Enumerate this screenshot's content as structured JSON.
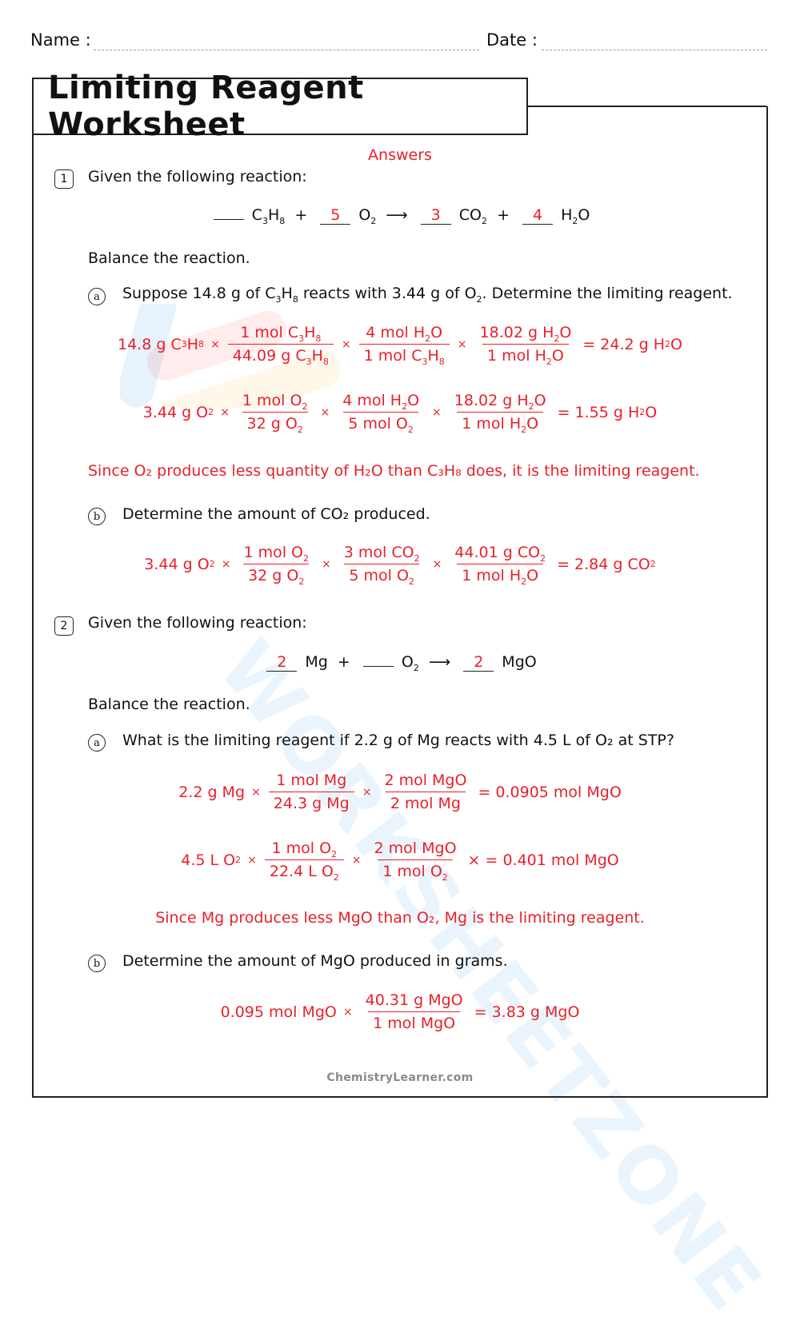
{
  "header": {
    "name_label": "Name :",
    "date_label": "Date :"
  },
  "title": "Limiting Reagent Worksheet",
  "answers_label": "Answers",
  "colors": {
    "answer": "#e8202a",
    "text": "#111111",
    "footer": "#8a8a8a"
  },
  "q1": {
    "number": "1",
    "prompt": "Given the following reaction:",
    "reaction": {
      "c1": "",
      "c2": "5",
      "c3": "3",
      "c4": "4"
    },
    "instruction": "Balance the reaction.",
    "a": {
      "marker": "a",
      "question_pre": "Suppose 14.8 g of C",
      "question_mid1": " reacts with 3.44 g of O",
      "question_post": ". Determine the limiting reagent.",
      "calc1": {
        "start": "14.8 g C",
        "f1_num": "1 mol C",
        "f1_den": "44.09 g C",
        "f2_num": "4 mol H",
        "f2_den": "1 mol C",
        "f3_num": "18.02 g H",
        "f3_den": "1 mol H",
        "result": "= 24.2 g H"
      },
      "calc2": {
        "start": "3.44 g O",
        "f1_num": "1 mol O",
        "f1_den": "32 g O",
        "f2_num": "4 mol H",
        "f2_den": "5 mol O",
        "f3_num": "18.02 g H",
        "f3_den": "1 mol H",
        "result": "= 1.55 g H"
      },
      "conclusion": "Since O₂ produces less quantity of H₂O than C₃H₈ does, it is the limiting reagent."
    },
    "b": {
      "marker": "b",
      "question": "Determine the amount of CO₂ produced.",
      "calc": {
        "start": "3.44 g O",
        "f1_num": "1 mol O",
        "f1_den": "32 g O",
        "f2_num": "3 mol CO",
        "f2_den": "5 mol O",
        "f3_num": "44.01 g CO",
        "f3_den": "1 mol H",
        "result": "= 2.84 g CO"
      }
    }
  },
  "q2": {
    "number": "2",
    "prompt": "Given the following reaction:",
    "reaction": {
      "c1": "2",
      "c2": "",
      "c3": "2"
    },
    "instruction": "Balance the reaction.",
    "a": {
      "marker": "a",
      "question": "What is the limiting reagent if 2.2 g of Mg reacts with 4.5 L of O₂ at STP?",
      "calc1": {
        "start": "2.2 g Mg",
        "f1_num": "1 mol Mg",
        "f1_den": "24.3 g Mg",
        "f2_num": "2 mol MgO",
        "f2_den": "2 mol Mg",
        "result": "= 0.0905 mol MgO"
      },
      "calc2": {
        "start": "4.5 L O",
        "f1_num": "1 mol O",
        "f1_den": "22.4 L O",
        "f2_num": "2 mol MgO",
        "f2_den": "1 mol O",
        "result": "× = 0.401 mol MgO"
      },
      "conclusion": "Since Mg produces less MgO than O₂, Mg is the limiting reagent."
    },
    "b": {
      "marker": "b",
      "question": "Determine the amount of MgO produced in grams.",
      "calc": {
        "start": "0.095 mol MgO",
        "f1_num": "40.31 g MgO",
        "f1_den": "1 mol MgO",
        "result": "= 3.83 g MgO"
      }
    }
  },
  "footer": "ChemistryLearner.com",
  "watermark": "WORKSHEETZONE"
}
